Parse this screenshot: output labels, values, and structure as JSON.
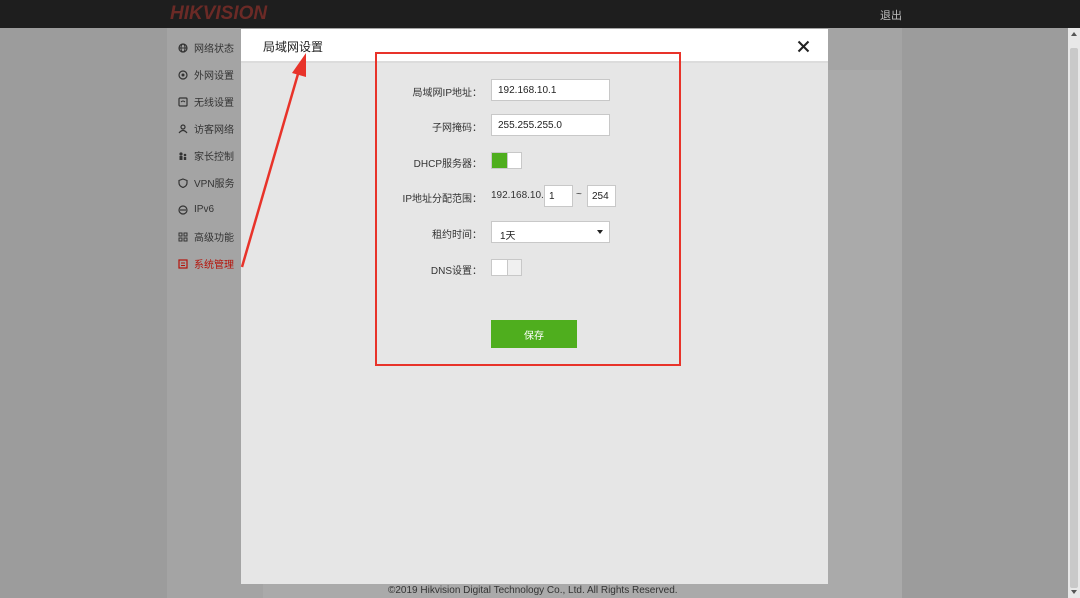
{
  "app": {
    "brand": "HIKVISION",
    "logout_label": "退出",
    "copyright": "©2019 Hikvision Digital Technology Co., Ltd. All Rights Reserved."
  },
  "sidebar": {
    "items": [
      {
        "label": "网络状态",
        "icon": "globe-icon",
        "active": false
      },
      {
        "label": "外网设置",
        "icon": "network-icon",
        "active": false
      },
      {
        "label": "无线设置",
        "icon": "wifi-icon",
        "active": false
      },
      {
        "label": "访客网络",
        "icon": "guest-icon",
        "active": false
      },
      {
        "label": "家长控制",
        "icon": "parental-icon",
        "active": false
      },
      {
        "label": "VPN服务",
        "icon": "vpn-icon",
        "active": false
      },
      {
        "label": "IPv6",
        "icon": "ipv6-icon",
        "active": false
      },
      {
        "label": "高级功能",
        "icon": "grid-icon",
        "active": false
      },
      {
        "label": "系统管理",
        "icon": "system-icon",
        "active": true
      }
    ]
  },
  "modal": {
    "title": "局域网设置",
    "lan_ip": {
      "label": "局域网IP地址：",
      "value": "192.168.10.1"
    },
    "subnet": {
      "label": "子网掩码：",
      "value": "255.255.255.0"
    },
    "dhcp": {
      "label": "DHCP服务器：",
      "enabled": true
    },
    "ip_range": {
      "label": "IP地址分配范围：",
      "prefix": "192.168.10.",
      "start": "1",
      "separator": "~",
      "end": "254"
    },
    "lease": {
      "label": "租约时间：",
      "selected": "1天"
    },
    "dns": {
      "label": "DNS设置：",
      "enabled": false
    },
    "save_label": "保存"
  },
  "colors": {
    "accent_green": "#4fae1e",
    "annotation_red": "#e8332a",
    "active_red": "#b5130a",
    "topbar": "#1e1e1e"
  }
}
